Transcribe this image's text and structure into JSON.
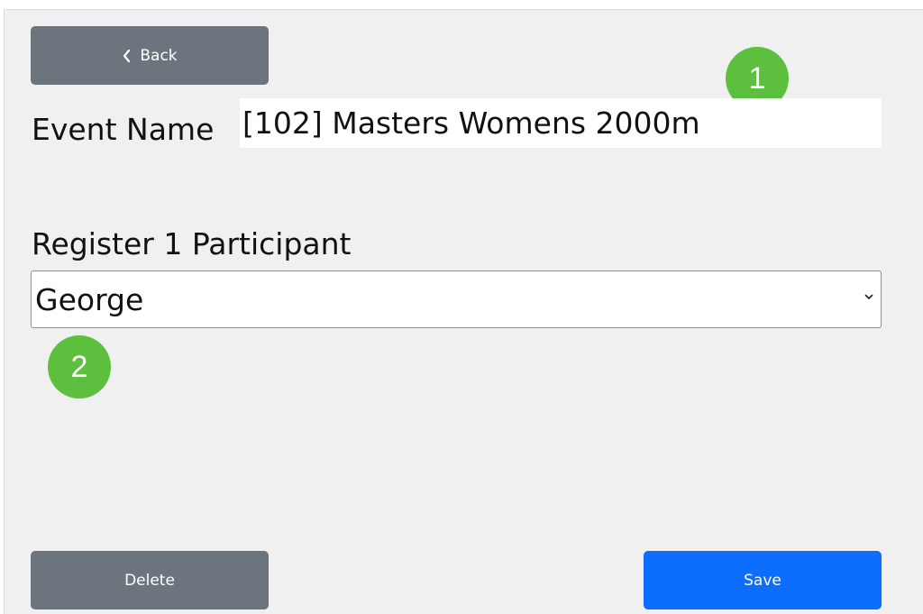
{
  "header": {
    "back_label": "Back",
    "back_icon": "chevron-left-icon"
  },
  "form": {
    "event_name_label": "Event Name",
    "event_name_value": "[102] Masters Womens 2000m",
    "register_label": "Register 1 Participant",
    "participant_selected": "George",
    "participant_chevron_icon": "chevron-down-icon"
  },
  "annotations": {
    "marker_1": "1",
    "marker_2": "2"
  },
  "footer": {
    "delete_label": "Delete",
    "save_label": "Save"
  },
  "colors": {
    "background": "#f0f0f0",
    "secondary_button": "#6c757d",
    "primary_button": "#0d6efd",
    "annotation_marker": "#5cbf3e"
  }
}
